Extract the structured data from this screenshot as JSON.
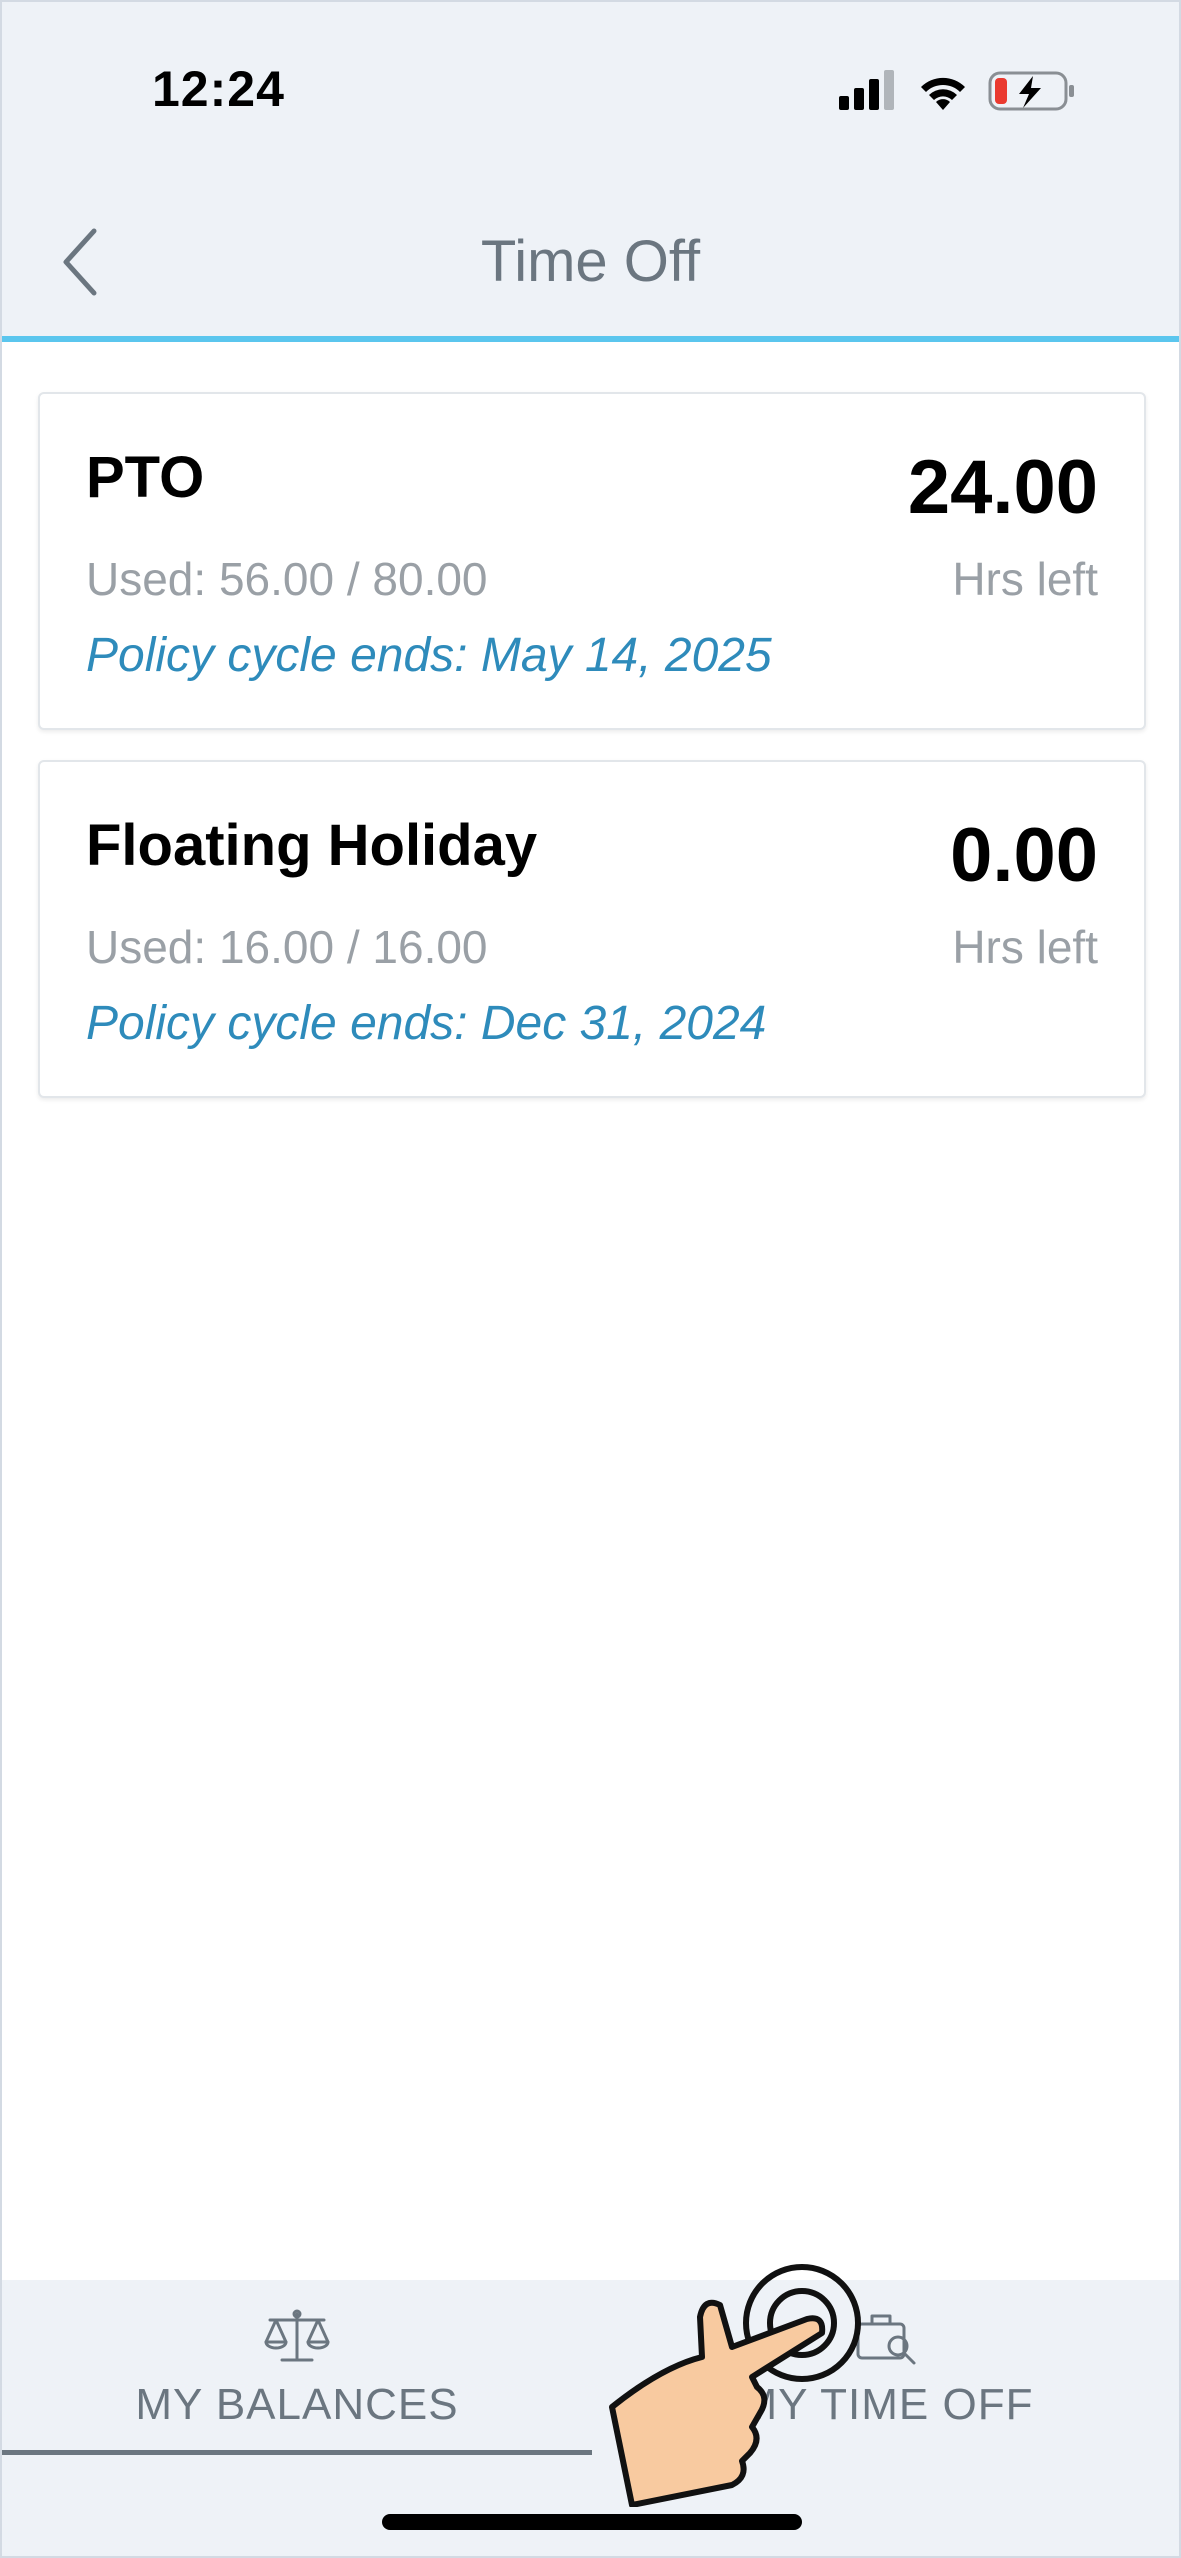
{
  "status_bar": {
    "time": "12:24",
    "icons": [
      "cellular-signal-icon",
      "wifi-icon",
      "battery-charging-icon"
    ]
  },
  "header": {
    "title": "Time Off",
    "back_icon": "chevron-left-icon"
  },
  "balances": [
    {
      "name": "PTO",
      "used": "Used: 56.00  / 80.00",
      "policy": "Policy cycle ends: May 14, 2025",
      "hours": "24.00",
      "hours_unit": "Hrs left"
    },
    {
      "name": "Floating Holiday",
      "used": "Used: 16.00  / 16.00",
      "policy": "Policy cycle ends: Dec 31, 2024",
      "hours": "0.00",
      "hours_unit": "Hrs left"
    }
  ],
  "tabs": [
    {
      "label": "MY BALANCES",
      "icon": "scale-icon",
      "active": true
    },
    {
      "label": "MY TIME OFF",
      "icon": "briefcase-search-icon",
      "active": false
    }
  ],
  "colors": {
    "header_bg": "#eef2f7",
    "accent_line": "#5bc6ee",
    "policy_text": "#2e8bbb",
    "muted_text": "#9aa0a6",
    "title_text": "#6b7680"
  }
}
